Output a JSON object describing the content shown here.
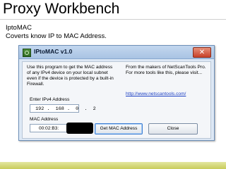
{
  "slide": {
    "title": "Proxy Workbench",
    "subtitle_lines": [
      "IptoMAC",
      "Coverts know IP to MAC Address."
    ]
  },
  "window": {
    "title": "IPtoMAC v1.0",
    "close_glyph": "✕"
  },
  "content": {
    "description_left": "Use this program to get the MAC address of any IPv4 device on your local subnet even if the device is protected by a built-in Firewall.",
    "description_right": "From the makers of NetScanTools Pro. For more tools like this, please visit...",
    "link": "http://www.netscantools.com/"
  },
  "ip_field": {
    "label": "Enter IPv4 Address",
    "value": " 192 .  168 .  0  .  2"
  },
  "mac_field": {
    "label": "MAC Address",
    "value": "00:02:B3:"
  },
  "buttons": {
    "get_mac": "Get MAC Address",
    "close": "Close"
  },
  "icons": {
    "app": "network-app-icon",
    "close": "close-icon"
  },
  "colors": {
    "window_bg": "#dde8f5",
    "titlebar": "#b6cce8",
    "close_button": "#c74128",
    "link": "#1b3fc4",
    "band": "#c8cc5a"
  }
}
